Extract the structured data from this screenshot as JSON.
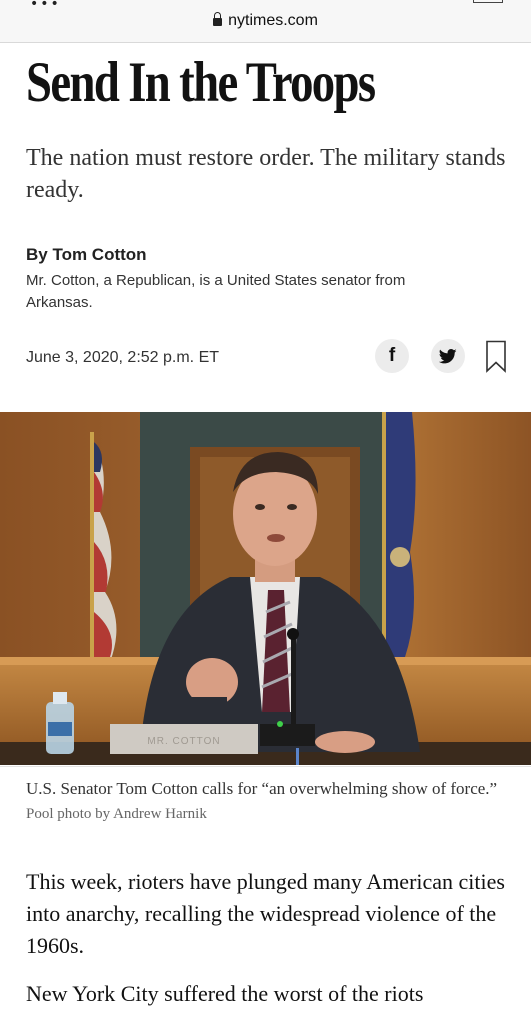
{
  "browser": {
    "url": "nytimes.com"
  },
  "article": {
    "headline": "Send In the Troops",
    "summary": "The nation must restore order. The military stands ready.",
    "byline": "By Tom Cotton",
    "author_bio": "Mr. Cotton, a Republican, is a United States senator from Arkansas.",
    "date": "June 3, 2020, 2:52 p.m. ET",
    "share": {
      "facebook_label": "f"
    },
    "photo": {
      "caption": "U.S. Senator Tom Cotton calls for “an overwhelming show of force.”",
      "credit": "Pool photo by Andrew Harnik",
      "nameplate": "MR. COTTON"
    },
    "paragraphs": [
      "This week, rioters have plunged many American cities into anarchy, recalling the widespread violence of the 1960s.",
      "New York City suffered the worst of the riots"
    ]
  },
  "colors": {
    "text": "#121212",
    "wood": "#a86a34",
    "suit": "#2a2d35"
  },
  "icons": {
    "lock": "lock-icon",
    "facebook": "facebook-icon",
    "twitter": "twitter-icon",
    "bookmark": "bookmark-icon"
  }
}
